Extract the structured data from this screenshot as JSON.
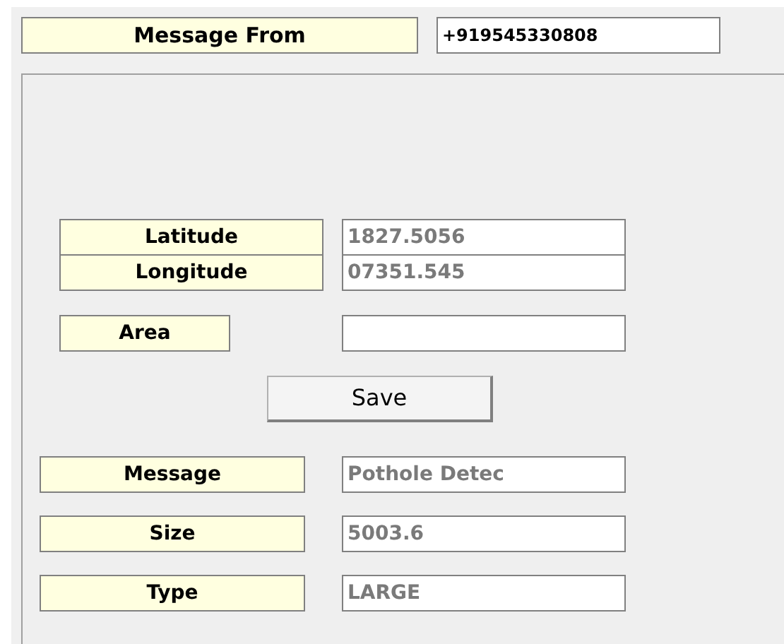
{
  "sender": {
    "label": "Message From",
    "value": "+919545330808"
  },
  "location": [
    {
      "label": "Latitude",
      "value": "1827.5056",
      "disabled": true
    },
    {
      "label": "Longitude",
      "value": "07351.545",
      "disabled": true
    }
  ],
  "area": {
    "label": "Area"
  },
  "save_button": "Save",
  "details": [
    {
      "label": "Message",
      "value": "Pothole Detec",
      "disabled": true
    },
    {
      "label": "Size",
      "value": "5003.6",
      "disabled": true
    },
    {
      "label": "Type",
      "value": "LARGE",
      "disabled": true
    }
  ]
}
